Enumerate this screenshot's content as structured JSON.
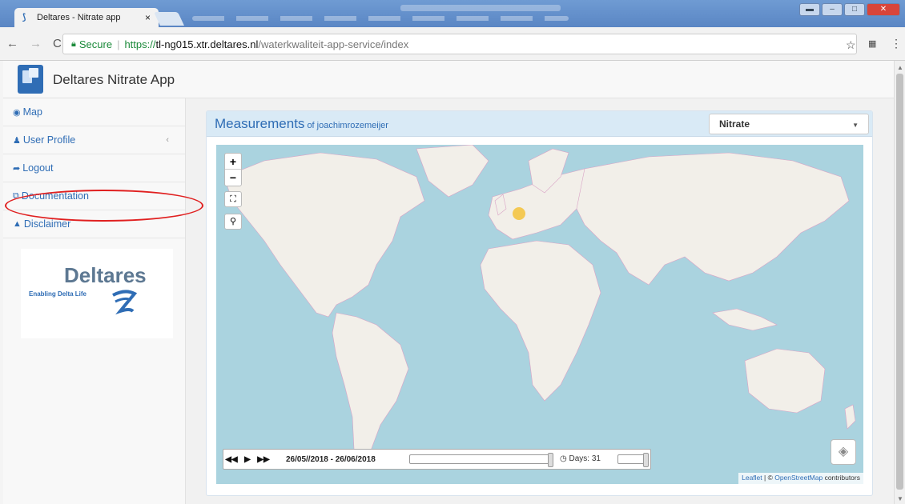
{
  "browser": {
    "tab_title": "Deltares - Nitrate app",
    "tab_close": "×",
    "url_secure_label": "Secure",
    "url_protocol": "https://",
    "url_host": "tl-ng015.xtr.deltares.nl",
    "url_path": "/waterkwaliteit-app-service/index"
  },
  "app": {
    "title": "Deltares Nitrate App"
  },
  "sidebar": {
    "items": [
      {
        "icon": "globe-icon",
        "glyph": "◉",
        "label": "Map"
      },
      {
        "icon": "user-icon",
        "glyph": "♟",
        "label": "User Profile",
        "chevron": "‹"
      },
      {
        "icon": "logout-icon",
        "glyph": "➦",
        "label": "Logout"
      },
      {
        "icon": "documentation-icon",
        "glyph": "⧉",
        "label": "Documentation"
      },
      {
        "icon": "warning-icon",
        "glyph": "▲",
        "label": "Disclaimer"
      }
    ],
    "logo": {
      "name": "Deltares",
      "tagline": "Enabling Delta Life"
    }
  },
  "panel": {
    "title": "Measurements",
    "subtitle": "of joachimrozemeijer",
    "parameter_select": "Nitrate"
  },
  "map": {
    "zoom_in": "+",
    "zoom_out": "−",
    "timeline": {
      "date_range": "26/05//2018 - 26/06/2018",
      "days_label": "Days: 31"
    },
    "attribution": {
      "leaflet": "Leaflet",
      "separator": " | © ",
      "osm": "OpenStreetMap",
      "contributors": " contributors"
    },
    "marker_color": "#f4c23a"
  },
  "colors": {
    "accent": "#2f6db5",
    "highlight_circle": "#e02020",
    "water": "#aad3df",
    "land": "#f2efe9"
  }
}
